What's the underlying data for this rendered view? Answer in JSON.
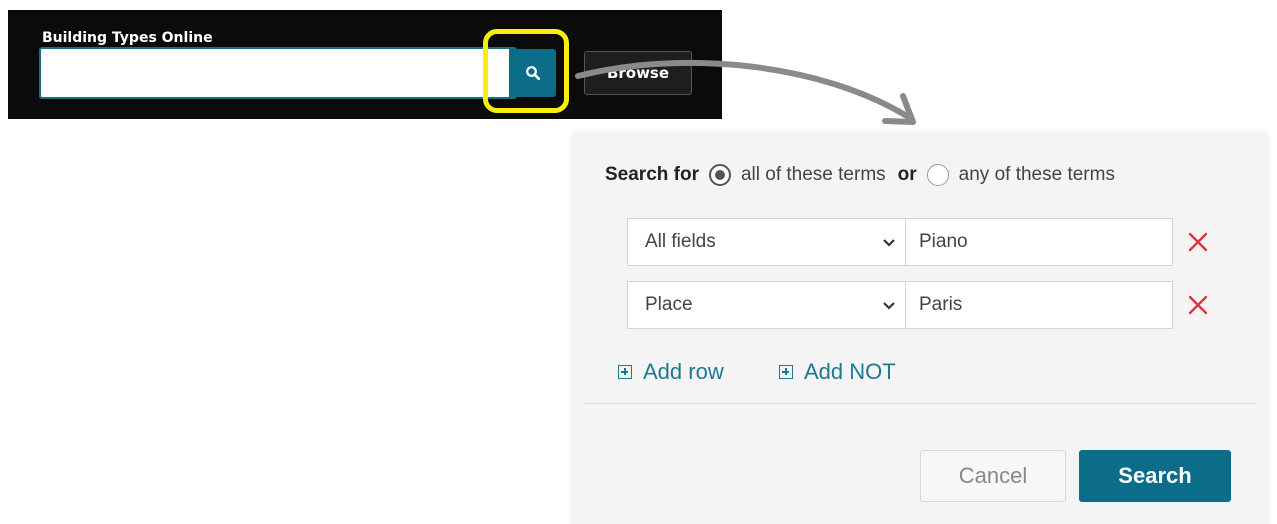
{
  "header": {
    "label": "Building Types Online",
    "search_value": "",
    "browse_label": "Browse"
  },
  "icons": {
    "search": "search-icon",
    "highlight": "highlight-frame",
    "arrow": "curved-arrow",
    "chevron": "chevron-down-icon",
    "remove": "close-icon",
    "add": "plus-square-icon"
  },
  "advanced_search": {
    "search_for_label": "Search for",
    "match_all_label": "all of these terms",
    "or_label": "or",
    "match_any_label": "any of these terms",
    "match_mode": "all",
    "rows": [
      {
        "field": "All fields",
        "value": "Piano"
      },
      {
        "field": "Place",
        "value": "Paris"
      }
    ],
    "add_row_label": "Add row",
    "add_not_label": "Add NOT",
    "cancel_label": "Cancel",
    "search_label": "Search"
  },
  "colors": {
    "accent": "#0b6d8a",
    "highlight": "#f7ee10",
    "remove": "#d9363e",
    "topbar_bg": "#0b0b0b",
    "panel_bg": "#f4f4f4"
  }
}
